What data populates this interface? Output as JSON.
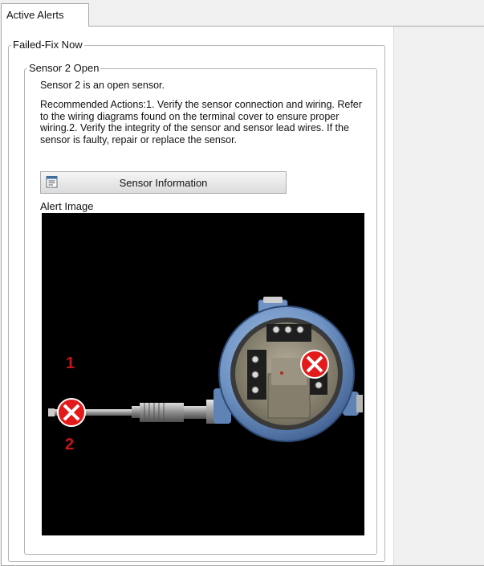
{
  "tabs": [
    {
      "label": "Active Alerts"
    }
  ],
  "groups": {
    "outer_legend": "Failed-Fix Now",
    "inner_legend": "Sensor 2 Open"
  },
  "alert": {
    "summary": "Sensor 2 is an open sensor.",
    "actions": "Recommended Actions:1. Verify the sensor connection and wiring.  Refer to the wiring diagrams found on the terminal cover to ensure proper wiring.2. Verify the integrity of the sensor and sensor lead wires.  If the sensor is faulty, repair or replace the sensor."
  },
  "buttons": {
    "sensor_info": "Sensor Information"
  },
  "image_section": {
    "label": "Alert Image",
    "wire_label_1": "1",
    "wire_label_2": "2"
  },
  "colors": {
    "alert_red": "#e41a1a",
    "housing_blue": "#6f93c4",
    "label_red": "#c8141b"
  },
  "icons": [
    "info-sheet-icon",
    "error-x-icon"
  ]
}
